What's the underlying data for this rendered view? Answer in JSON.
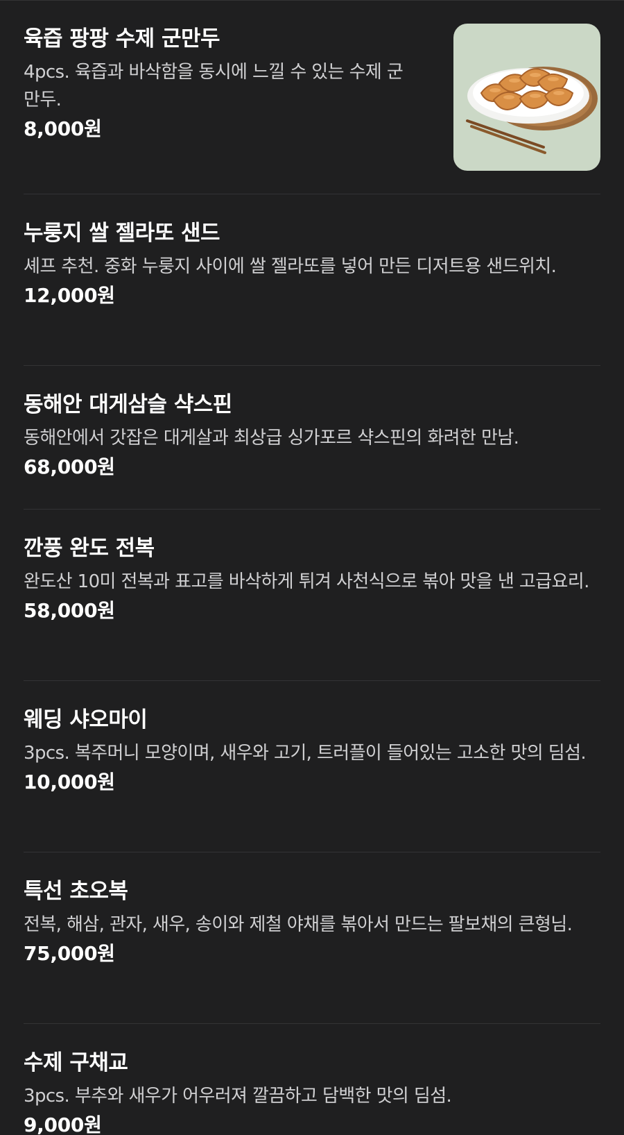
{
  "menu": {
    "items": [
      {
        "name": "육즙 팡팡 수제 군만두",
        "description": "4pcs. 육즙과 바삭함을 동시에 느낄 수 있는 수제 군만두.",
        "price": "8,000원",
        "has_photo": true
      },
      {
        "name": "누룽지 쌀 젤라또 샌드",
        "description": "셰프 추천. 중화 누룽지 사이에 쌀 젤라또를 넣어 만든 디저트용 샌드위치.",
        "price": "12,000원",
        "has_photo": false
      },
      {
        "name": "동해안 대게삼슬 샥스핀",
        "description": "동해안에서 갓잡은 대게살과 최상급 싱가포르 샥스핀의 화려한 만남.",
        "price": "68,000원",
        "has_photo": false
      },
      {
        "name": "깐풍 완도 전복",
        "description": "완도산 10미 전복과 표고를 바삭하게 튀겨 사천식으로 볶아 맛을 낸 고급요리.",
        "price": "58,000원",
        "has_photo": false
      },
      {
        "name": "웨딩 샤오마이",
        "description": "3pcs. 복주머니 모양이며, 새우와 고기, 트러플이 들어있는 고소한 맛의 딤섬.",
        "price": "10,000원",
        "has_photo": false
      },
      {
        "name": "특선 초오복",
        "description": "전복, 해삼, 관자, 새우, 송이와 제철 야채를 볶아서 만드는 팔보채의 큰형님.",
        "price": "75,000원",
        "has_photo": false
      },
      {
        "name": "수제 구채교",
        "description": "3pcs. 부추와 새우가 어우러져 깔끔하고 담백한 맛의 딤섬.",
        "price": "9,000원",
        "has_photo": false
      }
    ]
  },
  "colors": {
    "background": "#1f1f20",
    "divider": "#333335",
    "text_primary": "#ffffff",
    "text_secondary": "#d0d0d2",
    "photo_bg": "#c9d6c4"
  }
}
